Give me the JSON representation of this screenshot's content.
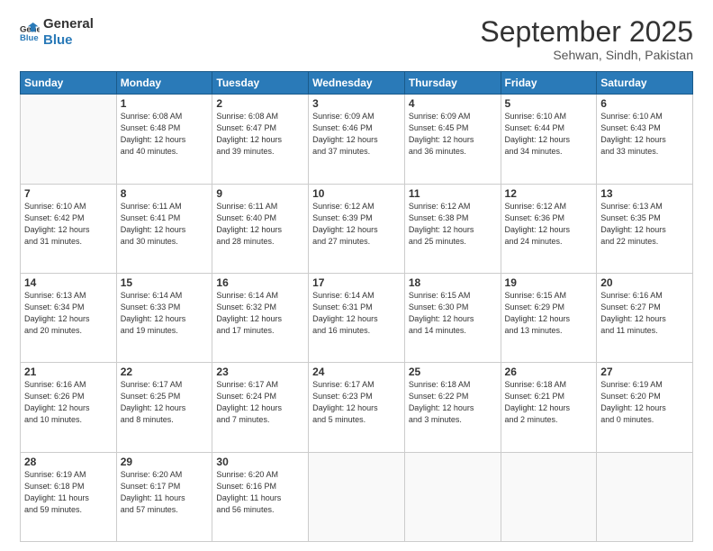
{
  "logo": {
    "line1": "General",
    "line2": "Blue"
  },
  "title": "September 2025",
  "location": "Sehwan, Sindh, Pakistan",
  "days_header": [
    "Sunday",
    "Monday",
    "Tuesday",
    "Wednesday",
    "Thursday",
    "Friday",
    "Saturday"
  ],
  "weeks": [
    [
      {
        "num": "",
        "info": ""
      },
      {
        "num": "1",
        "info": "Sunrise: 6:08 AM\nSunset: 6:48 PM\nDaylight: 12 hours\nand 40 minutes."
      },
      {
        "num": "2",
        "info": "Sunrise: 6:08 AM\nSunset: 6:47 PM\nDaylight: 12 hours\nand 39 minutes."
      },
      {
        "num": "3",
        "info": "Sunrise: 6:09 AM\nSunset: 6:46 PM\nDaylight: 12 hours\nand 37 minutes."
      },
      {
        "num": "4",
        "info": "Sunrise: 6:09 AM\nSunset: 6:45 PM\nDaylight: 12 hours\nand 36 minutes."
      },
      {
        "num": "5",
        "info": "Sunrise: 6:10 AM\nSunset: 6:44 PM\nDaylight: 12 hours\nand 34 minutes."
      },
      {
        "num": "6",
        "info": "Sunrise: 6:10 AM\nSunset: 6:43 PM\nDaylight: 12 hours\nand 33 minutes."
      }
    ],
    [
      {
        "num": "7",
        "info": "Sunrise: 6:10 AM\nSunset: 6:42 PM\nDaylight: 12 hours\nand 31 minutes."
      },
      {
        "num": "8",
        "info": "Sunrise: 6:11 AM\nSunset: 6:41 PM\nDaylight: 12 hours\nand 30 minutes."
      },
      {
        "num": "9",
        "info": "Sunrise: 6:11 AM\nSunset: 6:40 PM\nDaylight: 12 hours\nand 28 minutes."
      },
      {
        "num": "10",
        "info": "Sunrise: 6:12 AM\nSunset: 6:39 PM\nDaylight: 12 hours\nand 27 minutes."
      },
      {
        "num": "11",
        "info": "Sunrise: 6:12 AM\nSunset: 6:38 PM\nDaylight: 12 hours\nand 25 minutes."
      },
      {
        "num": "12",
        "info": "Sunrise: 6:12 AM\nSunset: 6:36 PM\nDaylight: 12 hours\nand 24 minutes."
      },
      {
        "num": "13",
        "info": "Sunrise: 6:13 AM\nSunset: 6:35 PM\nDaylight: 12 hours\nand 22 minutes."
      }
    ],
    [
      {
        "num": "14",
        "info": "Sunrise: 6:13 AM\nSunset: 6:34 PM\nDaylight: 12 hours\nand 20 minutes."
      },
      {
        "num": "15",
        "info": "Sunrise: 6:14 AM\nSunset: 6:33 PM\nDaylight: 12 hours\nand 19 minutes."
      },
      {
        "num": "16",
        "info": "Sunrise: 6:14 AM\nSunset: 6:32 PM\nDaylight: 12 hours\nand 17 minutes."
      },
      {
        "num": "17",
        "info": "Sunrise: 6:14 AM\nSunset: 6:31 PM\nDaylight: 12 hours\nand 16 minutes."
      },
      {
        "num": "18",
        "info": "Sunrise: 6:15 AM\nSunset: 6:30 PM\nDaylight: 12 hours\nand 14 minutes."
      },
      {
        "num": "19",
        "info": "Sunrise: 6:15 AM\nSunset: 6:29 PM\nDaylight: 12 hours\nand 13 minutes."
      },
      {
        "num": "20",
        "info": "Sunrise: 6:16 AM\nSunset: 6:27 PM\nDaylight: 12 hours\nand 11 minutes."
      }
    ],
    [
      {
        "num": "21",
        "info": "Sunrise: 6:16 AM\nSunset: 6:26 PM\nDaylight: 12 hours\nand 10 minutes."
      },
      {
        "num": "22",
        "info": "Sunrise: 6:17 AM\nSunset: 6:25 PM\nDaylight: 12 hours\nand 8 minutes."
      },
      {
        "num": "23",
        "info": "Sunrise: 6:17 AM\nSunset: 6:24 PM\nDaylight: 12 hours\nand 7 minutes."
      },
      {
        "num": "24",
        "info": "Sunrise: 6:17 AM\nSunset: 6:23 PM\nDaylight: 12 hours\nand 5 minutes."
      },
      {
        "num": "25",
        "info": "Sunrise: 6:18 AM\nSunset: 6:22 PM\nDaylight: 12 hours\nand 3 minutes."
      },
      {
        "num": "26",
        "info": "Sunrise: 6:18 AM\nSunset: 6:21 PM\nDaylight: 12 hours\nand 2 minutes."
      },
      {
        "num": "27",
        "info": "Sunrise: 6:19 AM\nSunset: 6:20 PM\nDaylight: 12 hours\nand 0 minutes."
      }
    ],
    [
      {
        "num": "28",
        "info": "Sunrise: 6:19 AM\nSunset: 6:18 PM\nDaylight: 11 hours\nand 59 minutes."
      },
      {
        "num": "29",
        "info": "Sunrise: 6:20 AM\nSunset: 6:17 PM\nDaylight: 11 hours\nand 57 minutes."
      },
      {
        "num": "30",
        "info": "Sunrise: 6:20 AM\nSunset: 6:16 PM\nDaylight: 11 hours\nand 56 minutes."
      },
      {
        "num": "",
        "info": ""
      },
      {
        "num": "",
        "info": ""
      },
      {
        "num": "",
        "info": ""
      },
      {
        "num": "",
        "info": ""
      }
    ]
  ]
}
